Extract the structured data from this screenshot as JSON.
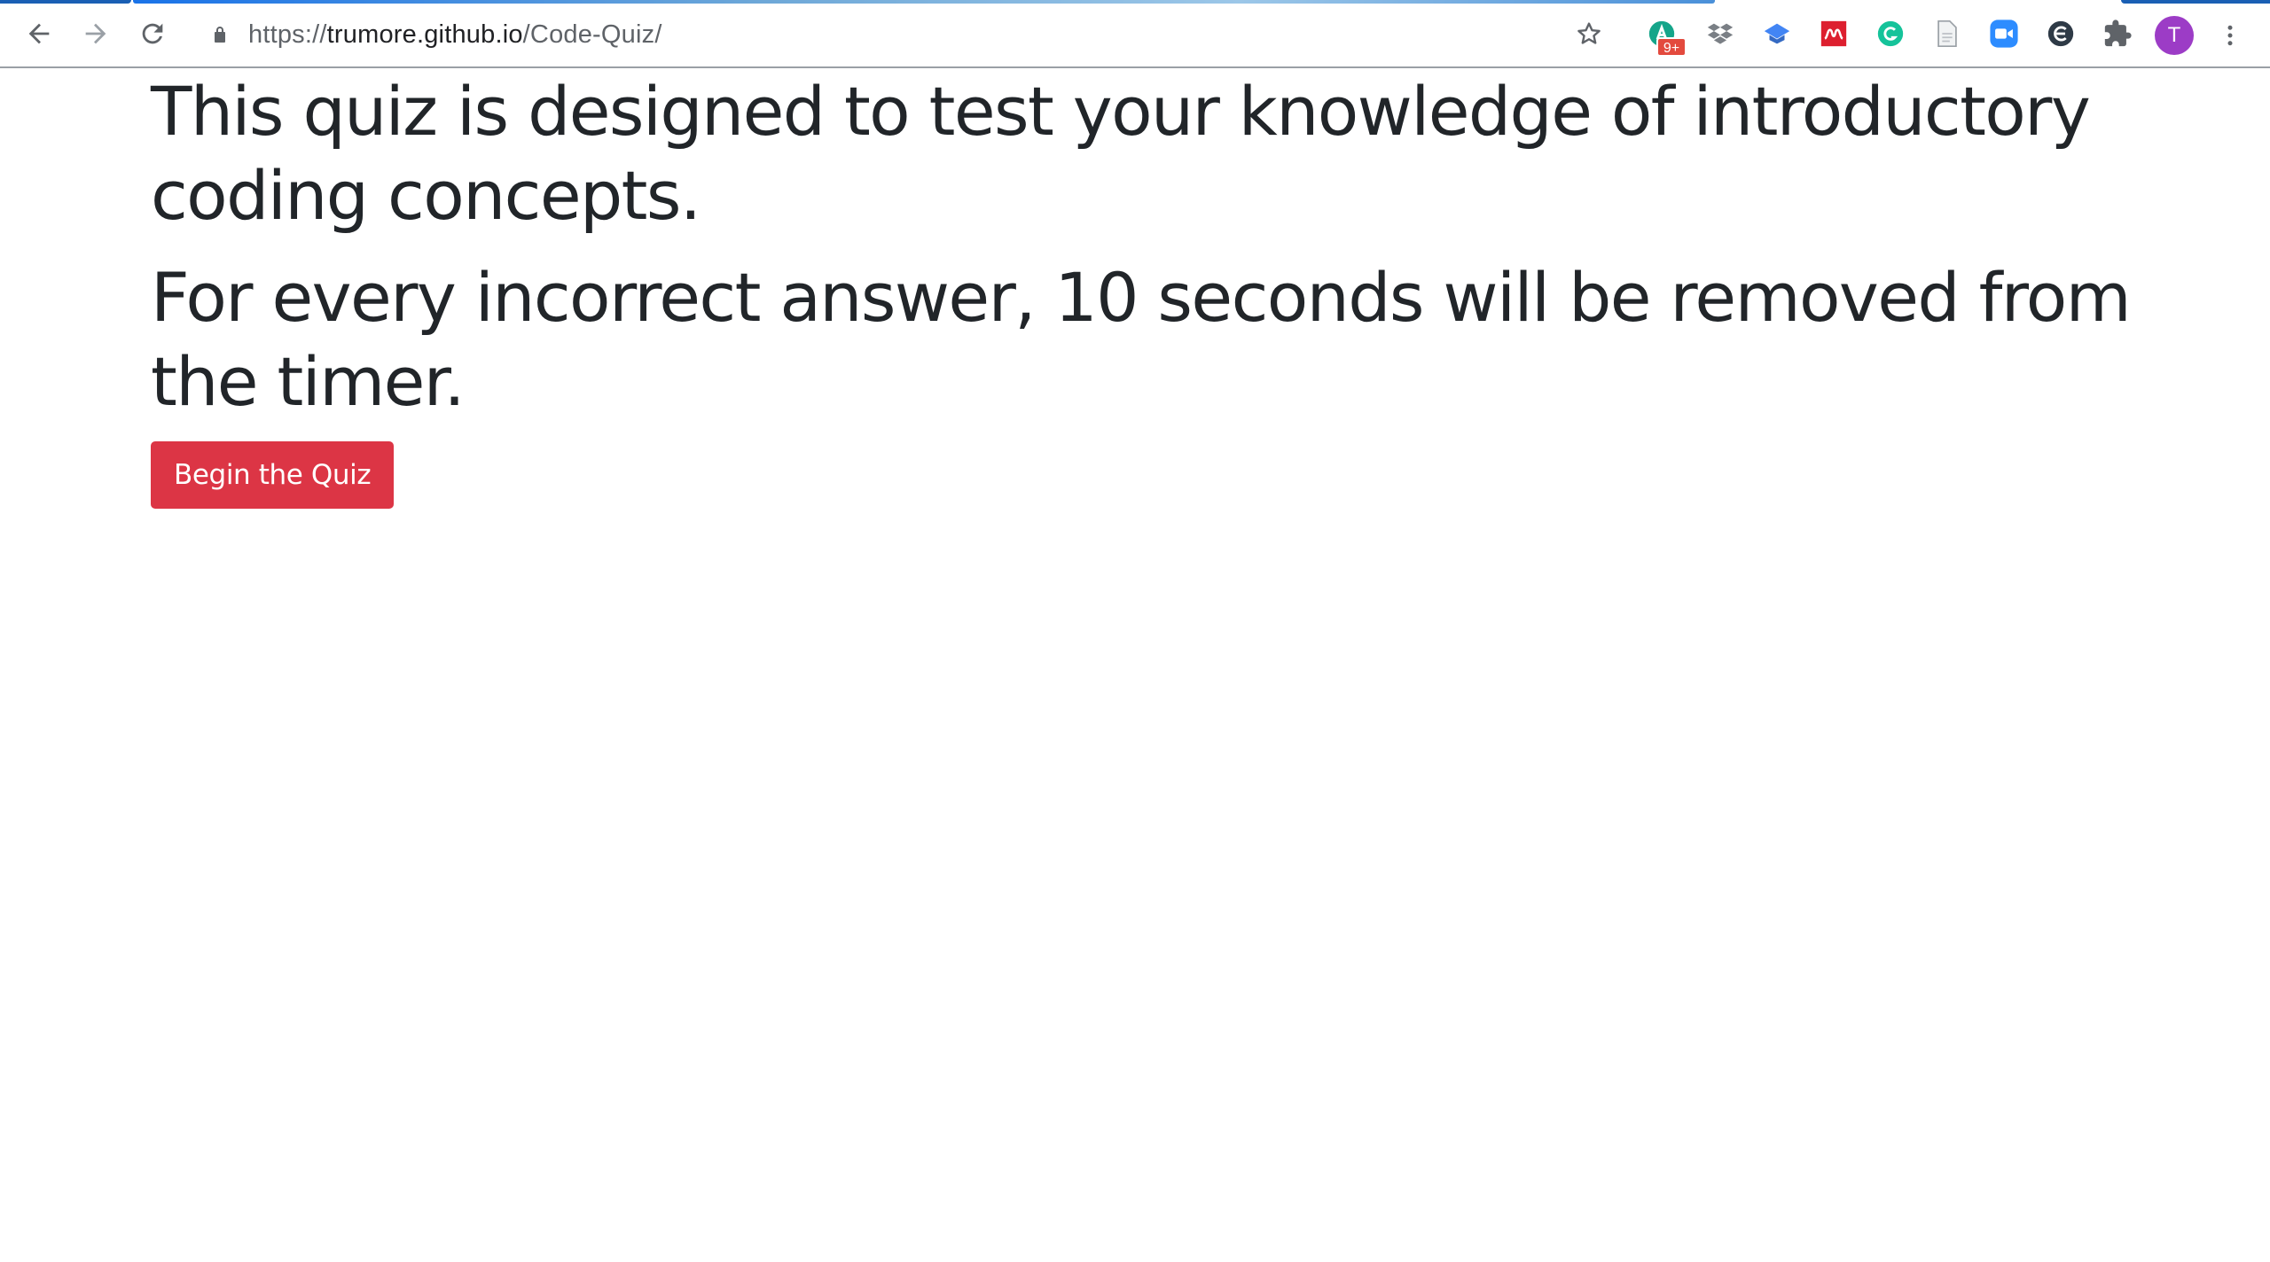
{
  "browser": {
    "url_scheme": "https://",
    "url_host": "trumore.github.io",
    "url_path": "/Code-Quiz/",
    "extension_badge": "9+",
    "profile_initial": "T"
  },
  "page": {
    "paragraphs": [
      "This quiz is designed to test your knowledge of introductory coding concepts.",
      "For every incorrect answer, 10 seconds will be removed from the timer."
    ],
    "begin_button_label": "Begin the Quiz"
  },
  "colors": {
    "button_bg": "#dc3545",
    "text": "#212529",
    "avatar": "#9c3cc6"
  }
}
